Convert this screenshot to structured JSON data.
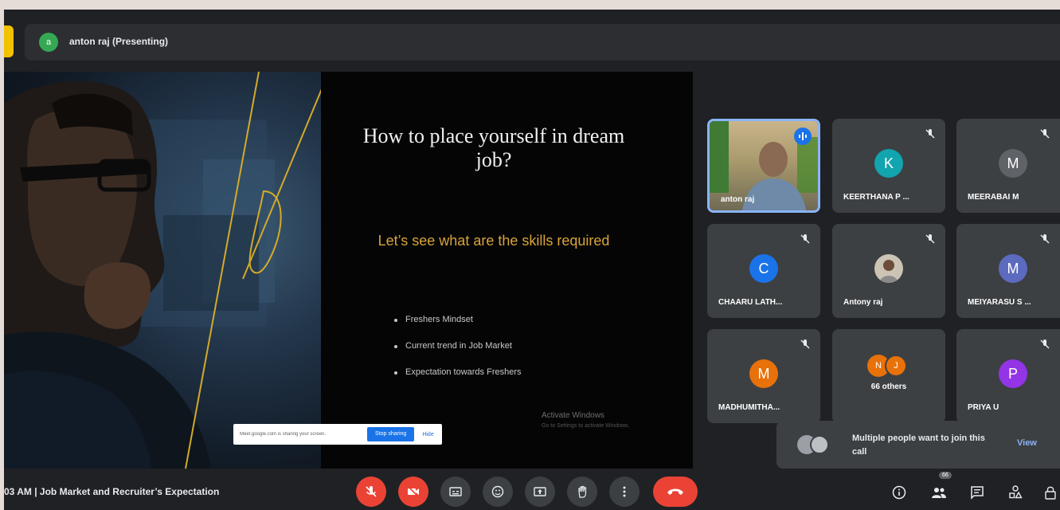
{
  "presenter": {
    "label": "anton raj (Presenting)",
    "avatar_letter": "a"
  },
  "slide": {
    "title": "How to place yourself in dream job?",
    "subtitle": "Let’s see what are the skills required",
    "bullets": [
      "Freshers Mindset",
      "Current trend in Job Market",
      "Expectation towards Freshers"
    ],
    "watermark": "Activate Windows",
    "watermark_sub": "Go to Settings to activate Windows."
  },
  "share_banner": {
    "text": "Meet.google.com is sharing your screen.",
    "stop_label": "Stop sharing",
    "hide_label": "Hide"
  },
  "participants": [
    {
      "name": "anton raj",
      "type": "video",
      "speaking": true
    },
    {
      "name": "KEERTHANA P ...",
      "letter": "K",
      "color": "#12a4af"
    },
    {
      "name": "MEERABAI M",
      "letter": "M",
      "color": "#5f6368"
    },
    {
      "name": "CHAARU LATH...",
      "letter": "C",
      "color": "#1a73e8"
    },
    {
      "name": "Antony raj",
      "letter": "",
      "color": "#b9b4a8",
      "photo": true
    },
    {
      "name": "MEIYARASU S ...",
      "letter": "M",
      "color": "#5c6bc0"
    },
    {
      "name": "MADHUMITHA...",
      "letter": "M",
      "color": "#e8710a"
    },
    {
      "name": "66 others",
      "letters": [
        "N",
        "J"
      ],
      "colors": [
        "#e8710a",
        "#e8710a"
      ]
    },
    {
      "name": "PRIYA U",
      "letter": "P",
      "color": "#9334e6"
    }
  ],
  "join_popup": {
    "text": "Multiple people want to join this call",
    "view_label": "View"
  },
  "meeting_info": "03 AM  |  Job Market and Recruiter’s Expectation",
  "people_count_badge": "66",
  "colors": {
    "end_call": "#ea4335",
    "accent": "#1a73e8",
    "slide_subtitle": "#d9a43a"
  }
}
